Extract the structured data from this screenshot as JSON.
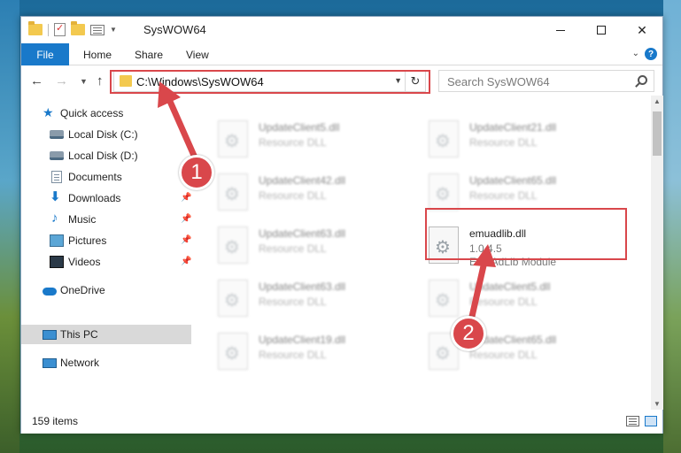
{
  "window": {
    "title": "SysWOW64"
  },
  "ribbon": {
    "tabs": [
      "File",
      "Home",
      "Share",
      "View"
    ]
  },
  "navigation": {
    "address": "C:\\Windows\\SysWOW64",
    "search_placeholder": "Search SysWOW64"
  },
  "sidebar": {
    "items": [
      {
        "label": "Quick access",
        "icon": "star-icon"
      },
      {
        "label": "Local Disk (C:)",
        "icon": "disk-icon"
      },
      {
        "label": "Local Disk (D:)",
        "icon": "disk-icon"
      },
      {
        "label": "Documents",
        "icon": "documents-icon",
        "pinned": true
      },
      {
        "label": "Downloads",
        "icon": "download-icon",
        "pinned": true
      },
      {
        "label": "Music",
        "icon": "music-icon",
        "pinned": true
      },
      {
        "label": "Pictures",
        "icon": "pictures-icon",
        "pinned": true
      },
      {
        "label": "Videos",
        "icon": "videos-icon",
        "pinned": true
      },
      {
        "label": "OneDrive",
        "icon": "cloud-icon"
      },
      {
        "label": "This PC",
        "icon": "pc-icon",
        "selected": true
      },
      {
        "label": "Network",
        "icon": "network-icon"
      }
    ]
  },
  "files": [
    {
      "name": "UpdateClient5.dll",
      "desc": "Resource DLL"
    },
    {
      "name": "UpdateClient21.dll",
      "desc": "Resource DLL"
    },
    {
      "name": "UpdateClient42.dll",
      "desc": "Resource DLL"
    },
    {
      "name": "UpdateClient65.dll",
      "desc": "Resource DLL"
    },
    {
      "name": "UpdateClient63.dll",
      "desc": "Resource DLL"
    },
    {
      "name": "emuadlib.dll",
      "version": "1.0.4.5",
      "desc": "EmuAdLib Module",
      "highlighted": true
    },
    {
      "name": "UpdateClient63.dll",
      "desc": "Resource DLL"
    },
    {
      "name": "UpdateClient5.dll",
      "desc": "Resource DLL"
    },
    {
      "name": "UpdateClient19.dll",
      "desc": "Resource DLL"
    },
    {
      "name": "UpdateClient65.dll",
      "desc": "Resource DLL"
    }
  ],
  "status": {
    "item_count": "159 items"
  },
  "annotations": {
    "step1": "1",
    "step2": "2",
    "color": "#d9474b"
  }
}
